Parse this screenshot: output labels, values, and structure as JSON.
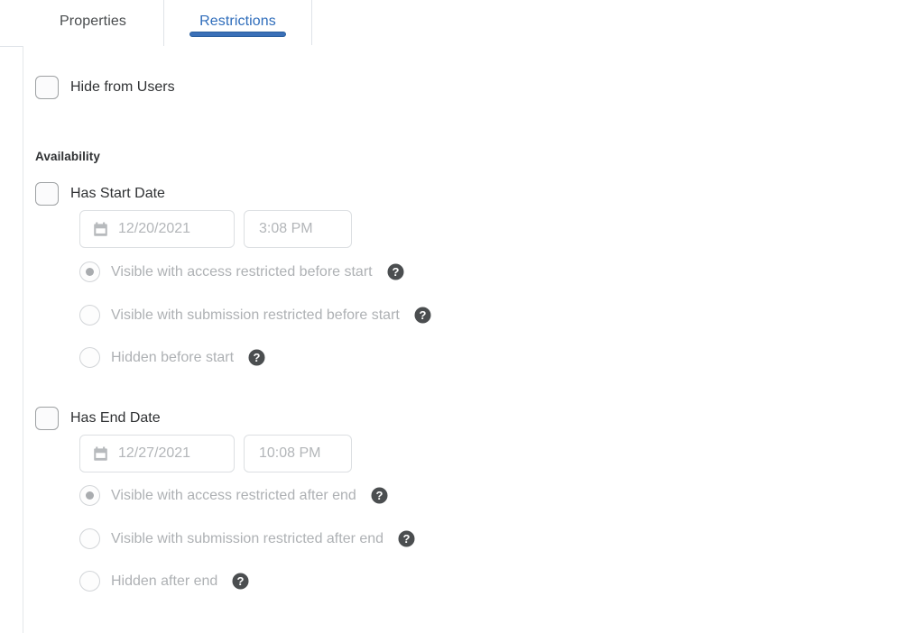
{
  "tabs": [
    {
      "label": "Properties",
      "active": false
    },
    {
      "label": "Restrictions",
      "active": true
    }
  ],
  "colors": {
    "active_tab_text": "#2f6dbb",
    "active_tab_underline": "#3a70b8",
    "inactive_tab_text": "#494c4e",
    "body_text": "#2f3133",
    "disabled_text": "#aeb1b4",
    "field_placeholder": "#b3b6b9",
    "border": "#dfe3e8"
  },
  "hide_from_users": {
    "label": "Hide from Users",
    "checked": false,
    "icon": "checkbox-icon"
  },
  "availability": {
    "heading": "Availability",
    "start": {
      "checkbox_label": "Has Start Date",
      "checked": false,
      "date_value": "12/20/2021",
      "time_value": "3:08 PM",
      "calendar_icon": "calendar-icon",
      "options": [
        {
          "label": "Visible with access restricted before start",
          "selected": true,
          "help_icon": "help-circle-icon"
        },
        {
          "label": "Visible with submission restricted before start",
          "selected": false,
          "help_icon": "help-circle-icon"
        },
        {
          "label": "Hidden before start",
          "selected": false,
          "help_icon": "help-circle-icon"
        }
      ]
    },
    "end": {
      "checkbox_label": "Has End Date",
      "checked": false,
      "date_value": "12/27/2021",
      "time_value": "10:08 PM",
      "calendar_icon": "calendar-icon",
      "options": [
        {
          "label": "Visible with access restricted after end",
          "selected": true,
          "help_icon": "help-circle-icon"
        },
        {
          "label": "Visible with submission restricted after end",
          "selected": false,
          "help_icon": "help-circle-icon"
        },
        {
          "label": "Hidden after end",
          "selected": false,
          "help_icon": "help-circle-icon"
        }
      ]
    }
  }
}
